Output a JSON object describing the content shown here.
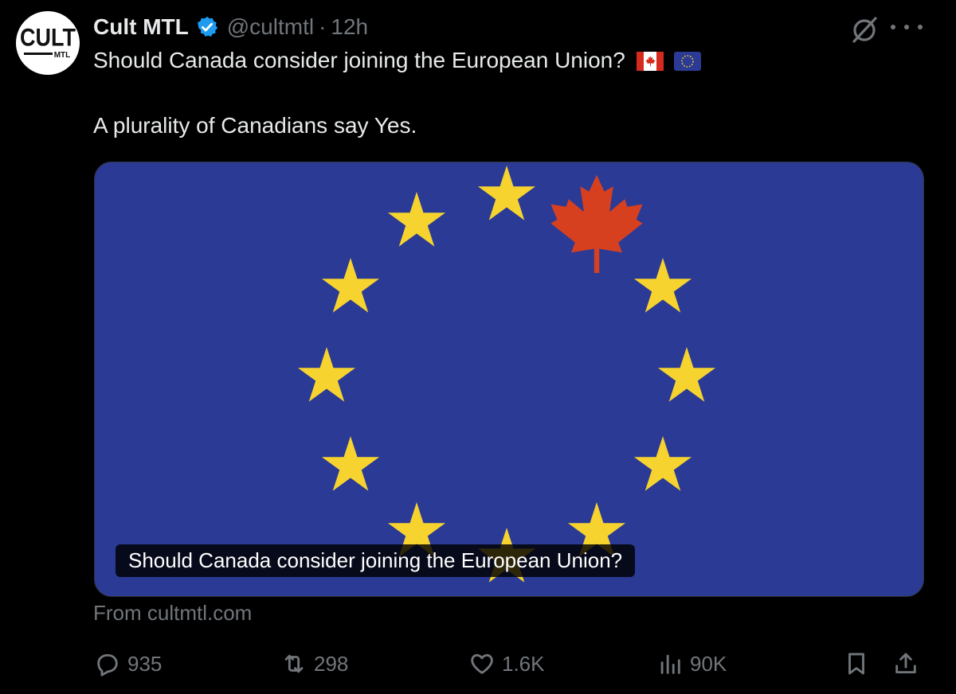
{
  "tweet": {
    "author_name": "Cult MTL",
    "handle": "@cultmtl",
    "separator": "·",
    "time": "12h",
    "avatar_text_main": "CULT",
    "avatar_text_sub": "MTL",
    "line1": "Should Canada consider joining the European Union?",
    "line2": "A plurality of Canadians say Yes.",
    "flag_emojis": [
      "canada-flag-icon",
      "eu-flag-icon"
    ]
  },
  "media": {
    "caption": "Should Canada consider joining the European Union?",
    "colors": {
      "flag_blue": "#2b3a94",
      "star_yellow": "#f6d32f",
      "maple_red": "#d6401f"
    }
  },
  "link_source": "From cultmtl.com",
  "actions": {
    "replies": "935",
    "reposts": "298",
    "likes": "1.6K",
    "views": "90K"
  },
  "colors": {
    "background": "#000000",
    "text": "#e7e9ea",
    "muted": "#71767b",
    "verified": "#1d9bf0"
  }
}
